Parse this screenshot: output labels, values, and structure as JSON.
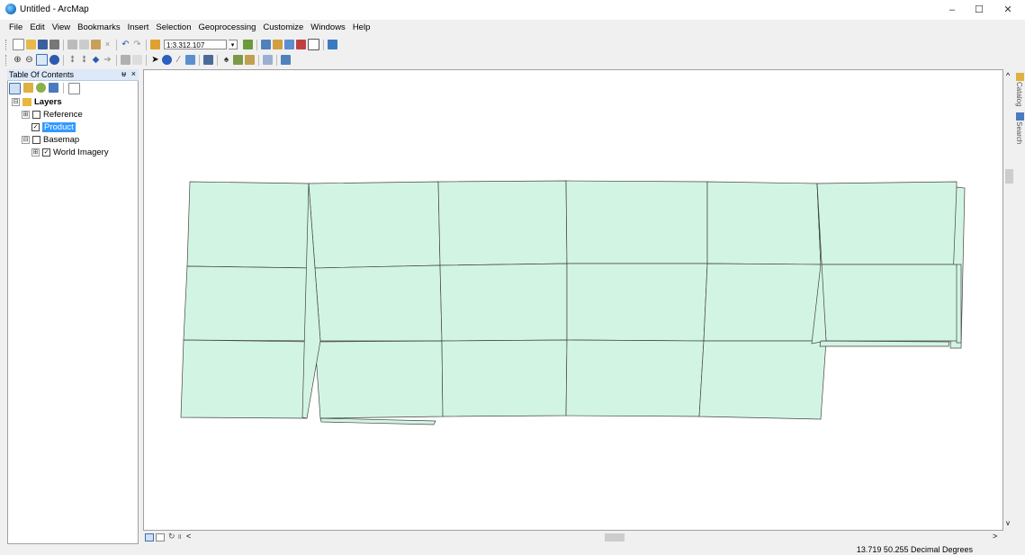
{
  "window": {
    "title": "Untitled - ArcMap",
    "minimize": "–",
    "maximize": "☐",
    "close": "✕"
  },
  "menubar": {
    "items": [
      "File",
      "Edit",
      "View",
      "Bookmarks",
      "Insert",
      "Selection",
      "Geoprocessing",
      "Customize",
      "Windows",
      "Help"
    ]
  },
  "toolbar": {
    "scale_value": "1:3.312.107"
  },
  "toc": {
    "title": "Table Of Contents",
    "pin_glyph": "ᵾ",
    "close_glyph": "×",
    "layers_group": "Layers",
    "reference": "Reference",
    "product": "Product",
    "basemap": "Basemap",
    "world_imagery": "World Imagery",
    "expand_plus": "⊞",
    "expand_minus": "⊟",
    "check_on": "✓",
    "check_off": ""
  },
  "map": {
    "fill_color": "#d2f5e3",
    "stroke_color": "#444444",
    "side_tabs": [
      "Catalog",
      "Search"
    ]
  },
  "scroll": {
    "up": "^",
    "down": "v",
    "left": "<",
    "right": ">"
  },
  "status": {
    "coordinates": "13.719  50.255 Decimal Degrees"
  },
  "colors": {
    "selection": "#3399ff",
    "panel_header": "#dde9f8"
  }
}
